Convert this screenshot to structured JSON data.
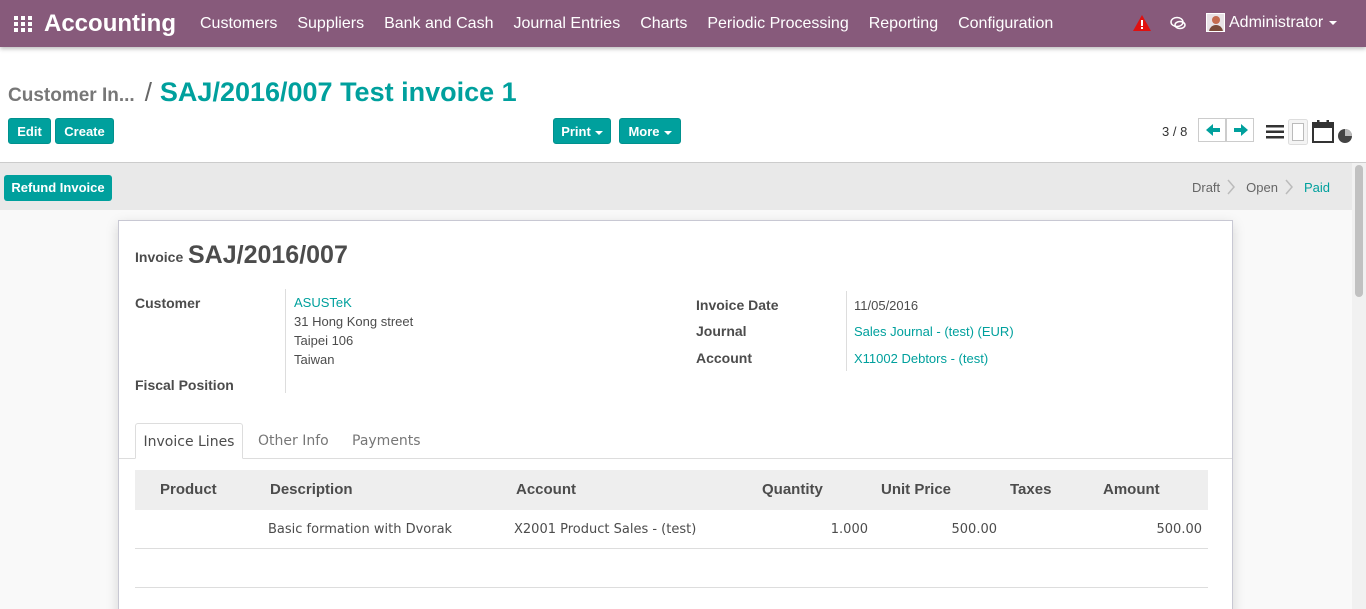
{
  "navbar": {
    "brand": "Accounting",
    "menu": [
      "Customers",
      "Suppliers",
      "Bank and Cash",
      "Journal Entries",
      "Charts",
      "Periodic Processing",
      "Reporting",
      "Configuration"
    ],
    "user": "Administrator"
  },
  "breadcrumb": {
    "parent": "Customer In...",
    "separator": "/",
    "current": "SAJ/2016/007 Test invoice 1"
  },
  "buttons": {
    "edit": "Edit",
    "create": "Create",
    "print": "Print",
    "more": "More"
  },
  "pager": {
    "text": "3 / 8"
  },
  "statusbar": {
    "refund": "Refund Invoice",
    "stages": [
      "Draft",
      "Open",
      "Paid"
    ],
    "active_stage": "Paid"
  },
  "invoice": {
    "label": "Invoice",
    "number": "SAJ/2016/007",
    "customer_label": "Customer",
    "customer_name": "ASUSTeK",
    "address_lines": [
      "31 Hong Kong street",
      "Taipei 106",
      "Taiwan"
    ],
    "fiscal_position_label": "Fiscal Position",
    "invoice_date_label": "Invoice Date",
    "invoice_date": "11/05/2016",
    "journal_label": "Journal",
    "journal": "Sales Journal - (test) (EUR)",
    "account_label": "Account",
    "account": "X11002 Debtors - (test)"
  },
  "tabs": [
    "Invoice Lines",
    "Other Info",
    "Payments"
  ],
  "lines": {
    "headers": [
      "Product",
      "Description",
      "Account",
      "Quantity",
      "Unit Price",
      "Taxes",
      "Amount"
    ],
    "rows": [
      {
        "product": "",
        "description": "Basic formation with Dvorak",
        "account": "X2001 Product Sales - (test)",
        "quantity": "1.000",
        "unit_price": "500.00",
        "taxes": "",
        "amount": "500.00"
      }
    ]
  },
  "colors": {
    "navbar": "#875a7b",
    "primary": "#00a09d",
    "warning": "#e01010"
  },
  "icons": [
    "apps-icon",
    "warning-icon",
    "chat-icon",
    "caret-down-icon",
    "arrow-left-icon",
    "arrow-right-icon",
    "list-view-icon",
    "form-view-icon",
    "calendar-view-icon",
    "graph-view-icon",
    "chevron-right-icon"
  ]
}
